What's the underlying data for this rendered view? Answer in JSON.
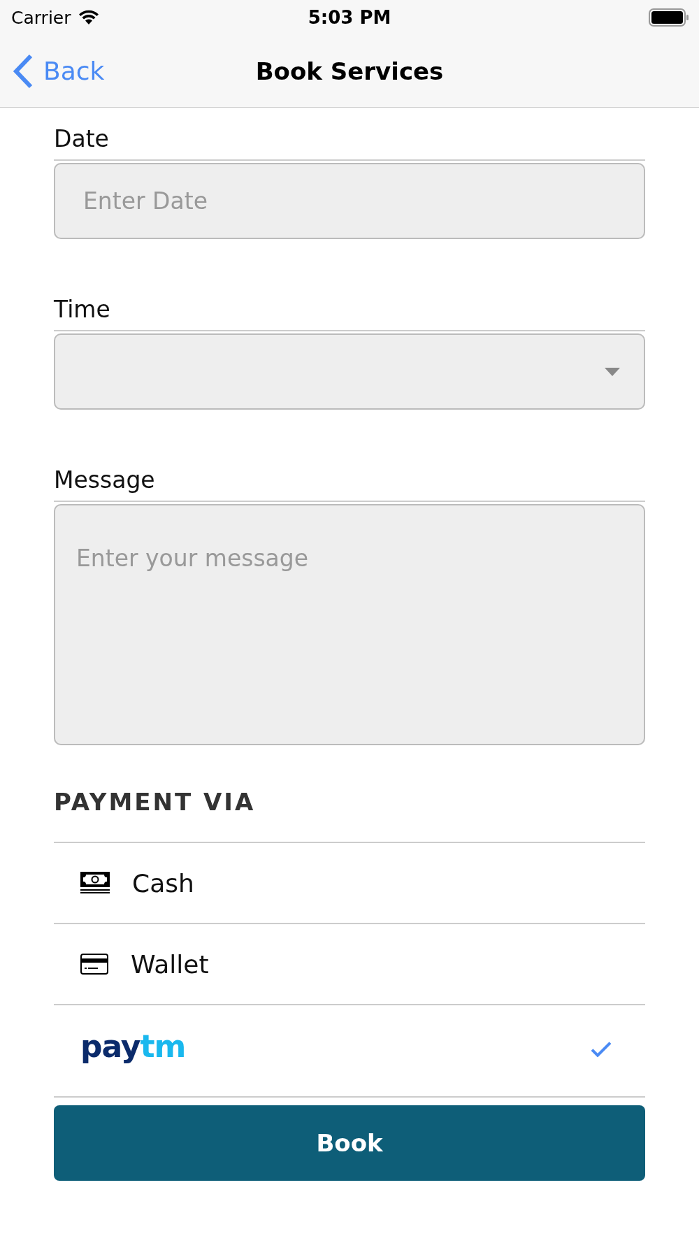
{
  "status_bar": {
    "carrier": "Carrier",
    "time": "5:03 PM"
  },
  "nav": {
    "back": "Back",
    "title": "Book Services"
  },
  "fields": [
    {
      "kind": "text",
      "label": "Date",
      "placeholder": "Enter Date"
    },
    {
      "kind": "select",
      "label": "Time"
    },
    {
      "kind": "textarea",
      "label": "Message",
      "placeholder": "Enter your message"
    }
  ],
  "payment": {
    "heading": "PAYMENT VIA",
    "options": [
      {
        "kind": "cash",
        "label": "Cash",
        "selected": false
      },
      {
        "kind": "wallet",
        "label": "Wallet",
        "selected": false
      },
      {
        "kind": "paytm",
        "logo": [
          "pay",
          "tm"
        ],
        "selected": true
      }
    ]
  },
  "book_button": "Book"
}
